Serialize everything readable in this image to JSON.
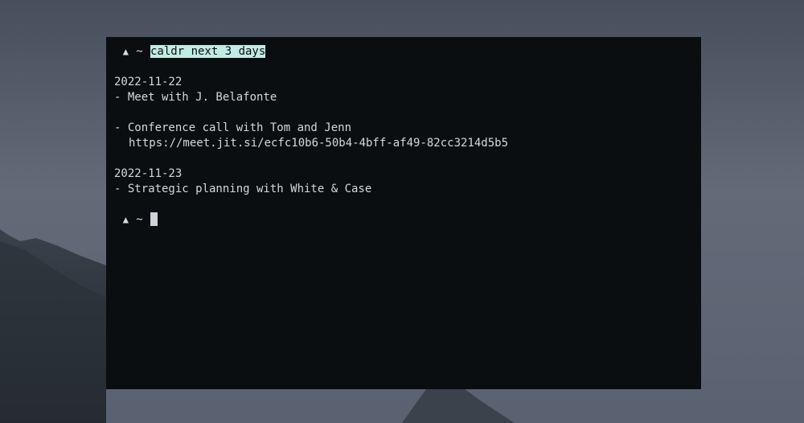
{
  "terminal": {
    "prompt_symbol": "▲",
    "prompt_dir": "~",
    "command": "caldr next 3 days",
    "output": {
      "day1": {
        "date": "2022-11-22",
        "event1": "- Meet with J. Belafonte",
        "event2": "- Conference call with Tom and Jenn",
        "event2_link": "https://meet.jit.si/ecfc10b6-50b4-4bff-af49-82cc3214d5b5"
      },
      "day2": {
        "date": "2022-11-23",
        "event1": "- Strategic planning with White & Case"
      }
    }
  },
  "colors": {
    "terminal_bg": "#0b0e10",
    "terminal_fg": "#d4d8dc",
    "command_highlight": "#c3ebe5"
  }
}
